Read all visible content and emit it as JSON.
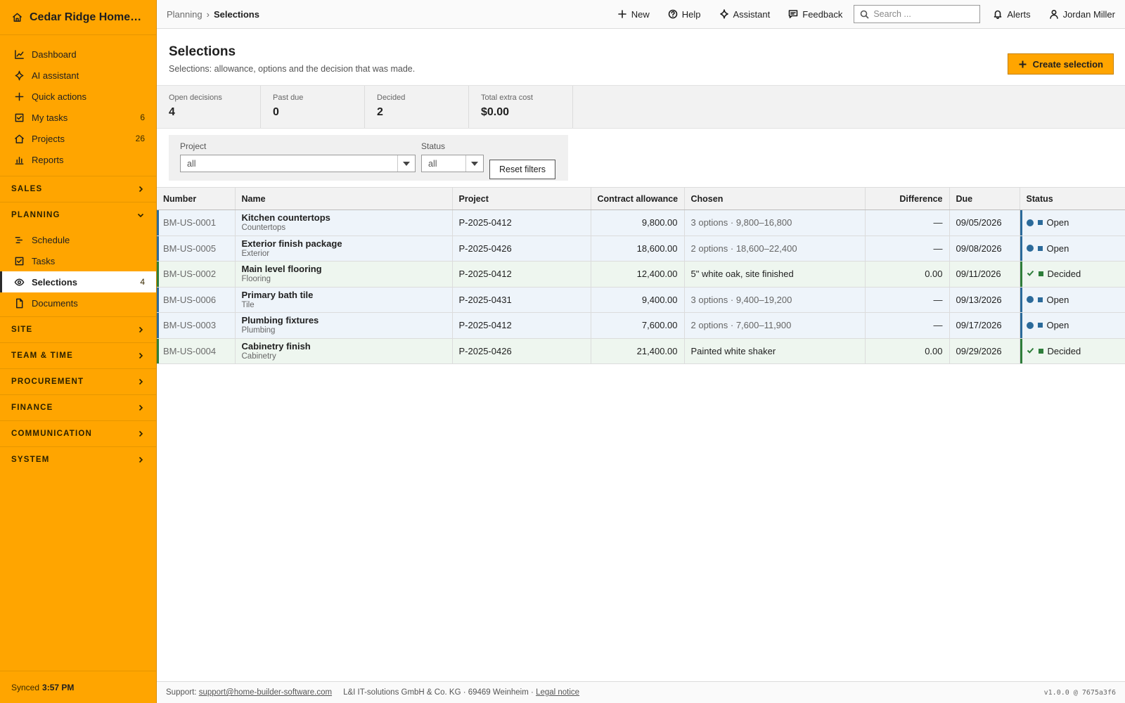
{
  "sidebar": {
    "brand": "Cedar Ridge Homes L...",
    "items": [
      {
        "label": "Dashboard",
        "icon": "chart-line-icon",
        "count": ""
      },
      {
        "label": "AI assistant",
        "icon": "sparkle-icon",
        "count": ""
      },
      {
        "label": "Quick actions",
        "icon": "plus-icon",
        "count": ""
      },
      {
        "label": "My tasks",
        "icon": "checkbox-icon",
        "count": "6"
      },
      {
        "label": "Projects",
        "icon": "house-icon",
        "count": "26"
      },
      {
        "label": "Reports",
        "icon": "bar-chart-icon",
        "count": ""
      }
    ],
    "sections": {
      "sales": "SALES",
      "planning": "PLANNING",
      "site": "SITE",
      "team_time": "TEAM & TIME",
      "procurement": "PROCUREMENT",
      "finance": "FINANCE",
      "communication": "COMMUNICATION",
      "system": "SYSTEM"
    },
    "planning_items": [
      {
        "label": "Schedule",
        "icon": "gantt-icon",
        "count": ""
      },
      {
        "label": "Tasks",
        "icon": "checkbox-icon",
        "count": ""
      },
      {
        "label": "Selections",
        "icon": "eye-icon",
        "count": "4"
      },
      {
        "label": "Documents",
        "icon": "document-icon",
        "count": ""
      }
    ],
    "footer_label": "Synced",
    "footer_time": "3:57 PM"
  },
  "topbar": {
    "breadcrumb_parent": "Planning",
    "breadcrumb_sep": "›",
    "breadcrumb_current": "Selections",
    "new_label": "New",
    "help_label": "Help",
    "assistant_label": "Assistant",
    "feedback_label": "Feedback",
    "search_placeholder": "Search ...",
    "alerts_label": "Alerts",
    "user_name": "Jordan Miller"
  },
  "header": {
    "title": "Selections",
    "subtitle": "Selections: allowance, options and the decision that was made.",
    "create_label": "Create selection"
  },
  "kpis": [
    {
      "label": "Open decisions",
      "value": "4"
    },
    {
      "label": "Past due",
      "value": "0"
    },
    {
      "label": "Decided",
      "value": "2"
    },
    {
      "label": "Total extra cost",
      "value": "$0.00"
    }
  ],
  "filters": {
    "project_label": "Project",
    "project_value": "all",
    "status_label": "Status",
    "status_value": "all",
    "reset_label": "Reset filters"
  },
  "table": {
    "columns": [
      "Number",
      "Name",
      "Project",
      "Contract allowance",
      "Chosen",
      "Difference",
      "Due",
      "Status"
    ],
    "rows": [
      {
        "number": "BM-US-0001",
        "name": "Kitchen countertops",
        "category": "Countertops",
        "project": "P-2025-0412",
        "allowance": "9,800.00",
        "chosen": "3 options · 9,800–16,800",
        "difference": "—",
        "due": "09/05/2026",
        "status": "Open"
      },
      {
        "number": "BM-US-0005",
        "name": "Exterior finish package",
        "category": "Exterior",
        "project": "P-2025-0426",
        "allowance": "18,600.00",
        "chosen": "2 options · 18,600–22,400",
        "difference": "—",
        "due": "09/08/2026",
        "status": "Open"
      },
      {
        "number": "BM-US-0002",
        "name": "Main level flooring",
        "category": "Flooring",
        "project": "P-2025-0412",
        "allowance": "12,400.00",
        "chosen": "5\" white oak, site finished",
        "difference": "0.00",
        "due": "09/11/2026",
        "status": "Decided"
      },
      {
        "number": "BM-US-0006",
        "name": "Primary bath tile",
        "category": "Tile",
        "project": "P-2025-0431",
        "allowance": "9,400.00",
        "chosen": "3 options · 9,400–19,200",
        "difference": "—",
        "due": "09/13/2026",
        "status": "Open"
      },
      {
        "number": "BM-US-0003",
        "name": "Plumbing fixtures",
        "category": "Plumbing",
        "project": "P-2025-0412",
        "allowance": "7,600.00",
        "chosen": "2 options · 7,600–11,900",
        "difference": "—",
        "due": "09/17/2026",
        "status": "Open"
      },
      {
        "number": "BM-US-0004",
        "name": "Cabinetry finish",
        "category": "Cabinetry",
        "project": "P-2025-0426",
        "allowance": "21,400.00",
        "chosen": "Painted white shaker",
        "difference": "0.00",
        "due": "09/29/2026",
        "status": "Decided"
      }
    ]
  },
  "footer": {
    "support_label": "Support:",
    "support_email": "support@home-builder-software.com",
    "company": "L&I IT-solutions GmbH & Co. KG · 69469 Weinheim ·",
    "legal_label": "Legal notice",
    "version": "v1.0.0 @ 7675a3f6"
  },
  "colors": {
    "sidebar_bg": "#ffa500",
    "accent": "#ffa500",
    "status_open": "#2b6a9a",
    "status_decided": "#2e7d3a",
    "row_open_bg": "#eef4fa",
    "row_decided_bg": "#eef6ef"
  }
}
